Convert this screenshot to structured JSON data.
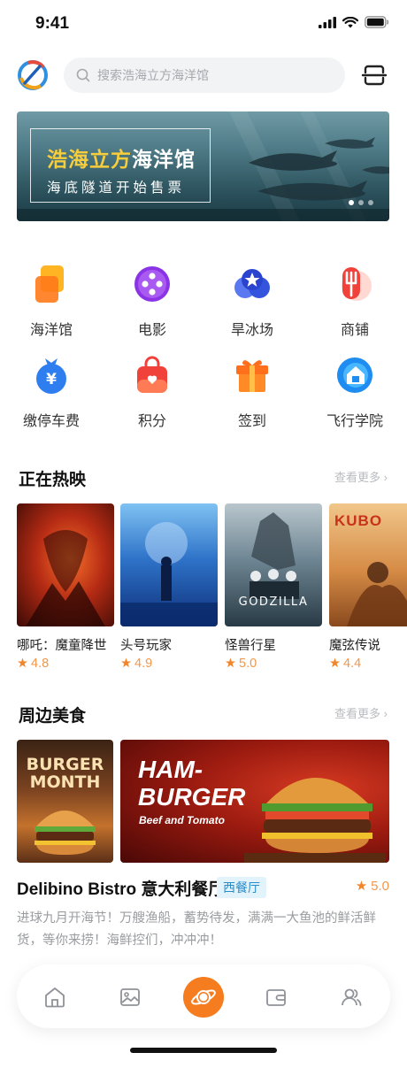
{
  "status_bar": {
    "time": "9:41"
  },
  "search": {
    "placeholder": "搜索浩海立方海洋馆"
  },
  "banner": {
    "title_part1": "浩海立方",
    "title_part2": "海洋馆",
    "subtitle": "海底隧道开始售票"
  },
  "categories": [
    {
      "label": "海洋馆",
      "icon": "ocean-museum-icon"
    },
    {
      "label": "电影",
      "icon": "movie-icon"
    },
    {
      "label": "旱冰场",
      "icon": "skating-rink-icon"
    },
    {
      "label": "商铺",
      "icon": "shop-icon"
    },
    {
      "label": "缴停车费",
      "icon": "parking-fee-icon"
    },
    {
      "label": "积分",
      "icon": "points-icon"
    },
    {
      "label": "签到",
      "icon": "checkin-icon"
    },
    {
      "label": "飞行学院",
      "icon": "flight-academy-icon"
    }
  ],
  "now_showing": {
    "title": "正在热映",
    "more": "查看更多",
    "movies": [
      {
        "name": "哪吒：魔童降世",
        "rating": "4.8",
        "poster_text": ""
      },
      {
        "name": "头号玩家",
        "rating": "4.9",
        "poster_text": ""
      },
      {
        "name": "怪兽行星",
        "rating": "5.0",
        "poster_text": "GODZILLA"
      },
      {
        "name": "魔弦传说",
        "rating": "4.4",
        "poster_text": "KUBO"
      }
    ]
  },
  "food": {
    "title": "周边美食",
    "more": "查看更多",
    "poster1_line1": "BURGER",
    "poster1_line2": "MONTH",
    "poster2_line1": "HAM-",
    "poster2_line2": "BURGER",
    "poster2_line3": "Beef and Tomato",
    "restaurant_name": "Delibino Bistro 意大利餐厅",
    "tag": "西餐厅",
    "rating": "5.0",
    "description": "进球九月开海节！万艘渔船，蓄势待发，满满一大鱼池的鲜活鲜货，等你来捞！海鲜控们，冲冲冲！"
  },
  "tabbar": {
    "items": [
      "home-icon",
      "gallery-icon",
      "planet-icon",
      "wallet-icon",
      "contacts-icon"
    ]
  },
  "colors": {
    "accent": "#f57c1f",
    "rating": "#f1852b",
    "tag_text": "#2a8bc9",
    "tag_bg": "#e3f3fb"
  }
}
